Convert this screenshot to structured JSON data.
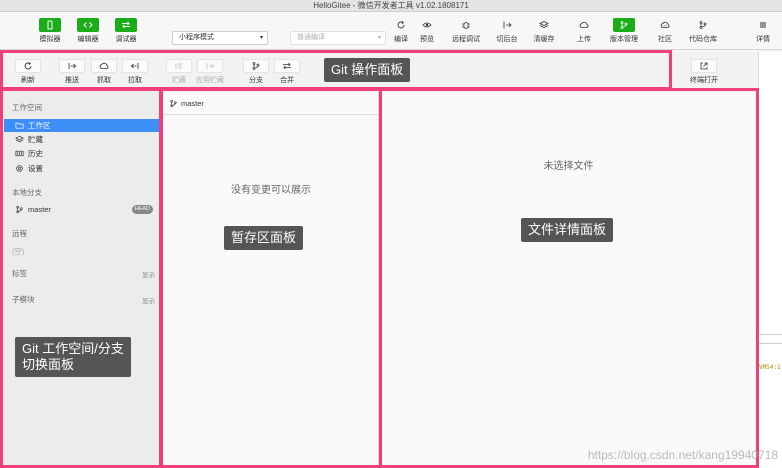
{
  "window": {
    "title": "HelloGitee - 微信开发者工具 v1.02.1808171"
  },
  "toolbar": {
    "simulator": "模拟器",
    "editor": "编辑器",
    "debugger": "调试器",
    "mode_select": "小程序模式",
    "compile_select": "普通编译",
    "compile": "编译",
    "preview": "预览",
    "remote_debug": "远程调试",
    "background": "切后台",
    "clear_cache": "清缓存",
    "upload": "上传",
    "version_mgmt": "版本管理",
    "community": "社区",
    "code_repo": "代码仓库",
    "details": "详情"
  },
  "git_toolbar": {
    "refresh": "刷新",
    "push": "推送",
    "fetch": "抓取",
    "pull": "拉取",
    "stash": "贮藏",
    "apply_stash": "应用贮藏",
    "branch": "分支",
    "merge": "合并",
    "open_terminal": "终端打开"
  },
  "sidebar": {
    "workspace_title": "工作空间",
    "items": [
      {
        "label": "工作区",
        "icon": "folder-icon"
      },
      {
        "label": "贮藏",
        "icon": "layers-icon"
      },
      {
        "label": "历史",
        "icon": "history-icon"
      },
      {
        "label": "设置",
        "icon": "gear-icon"
      }
    ],
    "local_branch_title": "本地分支",
    "branch_name": "master",
    "branch_badge": "HEAD",
    "remote_title": "远程",
    "remote_empty": "(空)",
    "tags_title": "标签",
    "tags_show": "显示",
    "submodule_title": "子模块",
    "submodule_show": "显示"
  },
  "staging": {
    "branch": "master",
    "empty_message": "没有变更可以展示"
  },
  "details_panel": {
    "empty_message": "未选择文件"
  },
  "annotations": {
    "git_ops": "Git 操作面板",
    "staging": "暂存区面板",
    "file_details": "文件详情面板",
    "workspace_line1": "Git 工作空间/分支",
    "workspace_line2": "切换面板"
  },
  "edge_code": "VM54:1",
  "watermark": "https://blog.csdn.net/kang19940718",
  "colors": {
    "accent_green": "#1aad19",
    "frame_pink": "#f0407a",
    "selection_blue": "#3d8ef7"
  }
}
